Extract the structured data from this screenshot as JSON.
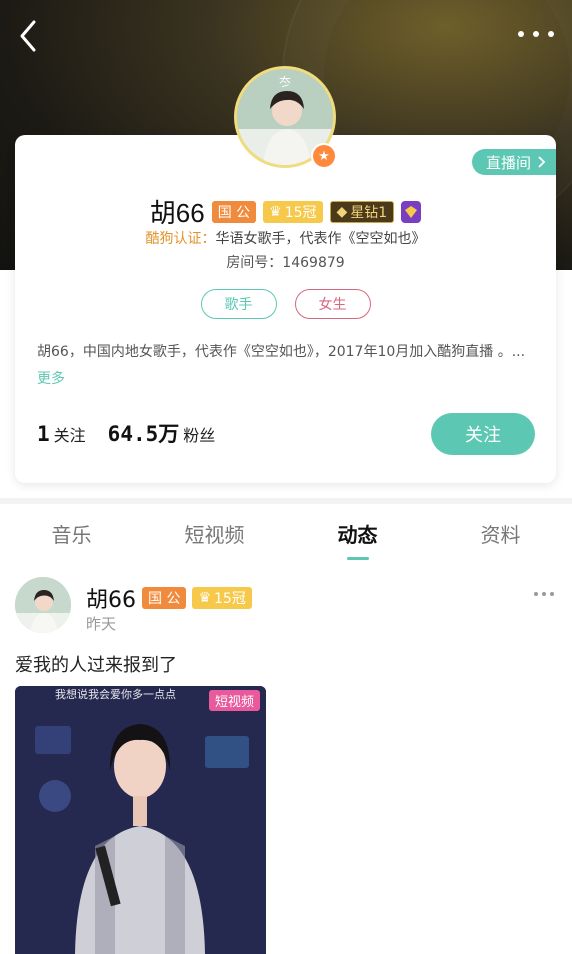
{
  "header": {
    "back": "‹",
    "more": "•••"
  },
  "profile": {
    "name": "胡66",
    "badges": {
      "guo": "国 公",
      "crown": "15冠",
      "star": "星钻1"
    },
    "live_button": "直播间",
    "cert_key": "酷狗认证：",
    "cert_value": "华语女歌手，代表作《空空如也》",
    "room": "房间号：1469879",
    "tags": [
      "歌手",
      "女生"
    ],
    "bio": "胡66，中国内地女歌手，代表作《空空如也》，2017年10月加入酷狗直播 。...",
    "bio_more": "更多",
    "follow_count": "1",
    "follow_label": "关注",
    "fans_count": "64.5万",
    "fans_label": "粉丝",
    "follow_button": "关注"
  },
  "tabs": [
    {
      "label": "音乐",
      "active": false
    },
    {
      "label": "短视频",
      "active": false
    },
    {
      "label": "动态",
      "active": true
    },
    {
      "label": "资料",
      "active": false
    }
  ],
  "post": {
    "name": "胡66",
    "badges": {
      "guo": "国 公",
      "crown": "15冠"
    },
    "time": "昨天",
    "text": "爱我的人过来报到了",
    "video_label": "短视频",
    "video_caption": "我想说我会爱你多一点点"
  },
  "colors": {
    "accent": "#5cc8b3",
    "pink": "#d9667f",
    "orange": "#f08a3c",
    "gold": "#f6c94a"
  }
}
